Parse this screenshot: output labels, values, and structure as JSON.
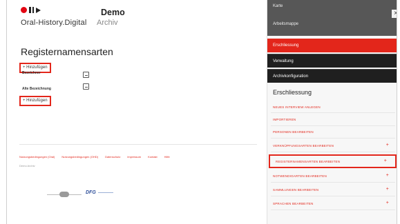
{
  "header": {
    "logo_text": "Oral-History.Digital",
    "title": "Demo",
    "subtitle": "Archiv"
  },
  "main": {
    "page_title": "Registernamensarten",
    "add_label": "+ Hinzufügen",
    "fields": [
      {
        "label": "Bezeichner"
      },
      {
        "label": "Alte Bezeichnung"
      }
    ]
  },
  "footer": {
    "links": [
      "Nutzungsbedingungen (Oral)",
      "Nutzungsbedingungen (OHD)",
      "Datenschutz",
      "Impressum",
      "Kontakt",
      "Hilfe"
    ],
    "version": "Demo Archiv"
  },
  "sidebar": {
    "top_items": [
      "Karte",
      "Arbeitsmappe"
    ],
    "menu": [
      "Erschliessung",
      "Verwaltung",
      "Archivkonfiguration"
    ],
    "active_item": "Erschliessung",
    "section_title": "Erschliessung",
    "sub_items": [
      "NEUES INTERVIEW ANLEGEN",
      "IMPORTIEREN",
      "PERSONEN BEARBEITEN",
      "VERKNÜPFUNGSARTEN BEARBEITEN",
      "REGISTERNAMENSARTEN BEARBEITEN",
      "NOTWENDIGARTEN BEARBEITEN",
      "SAMMLUNGEN BEARBEITEN",
      "SPRACHEN BEARBEITEN"
    ],
    "close_symbol": "×",
    "plus_symbol": "+"
  },
  "colors": {
    "accent": "#e3261b",
    "sidebar_dark": "#1f1f1f",
    "sidebar_top": "#575757"
  }
}
